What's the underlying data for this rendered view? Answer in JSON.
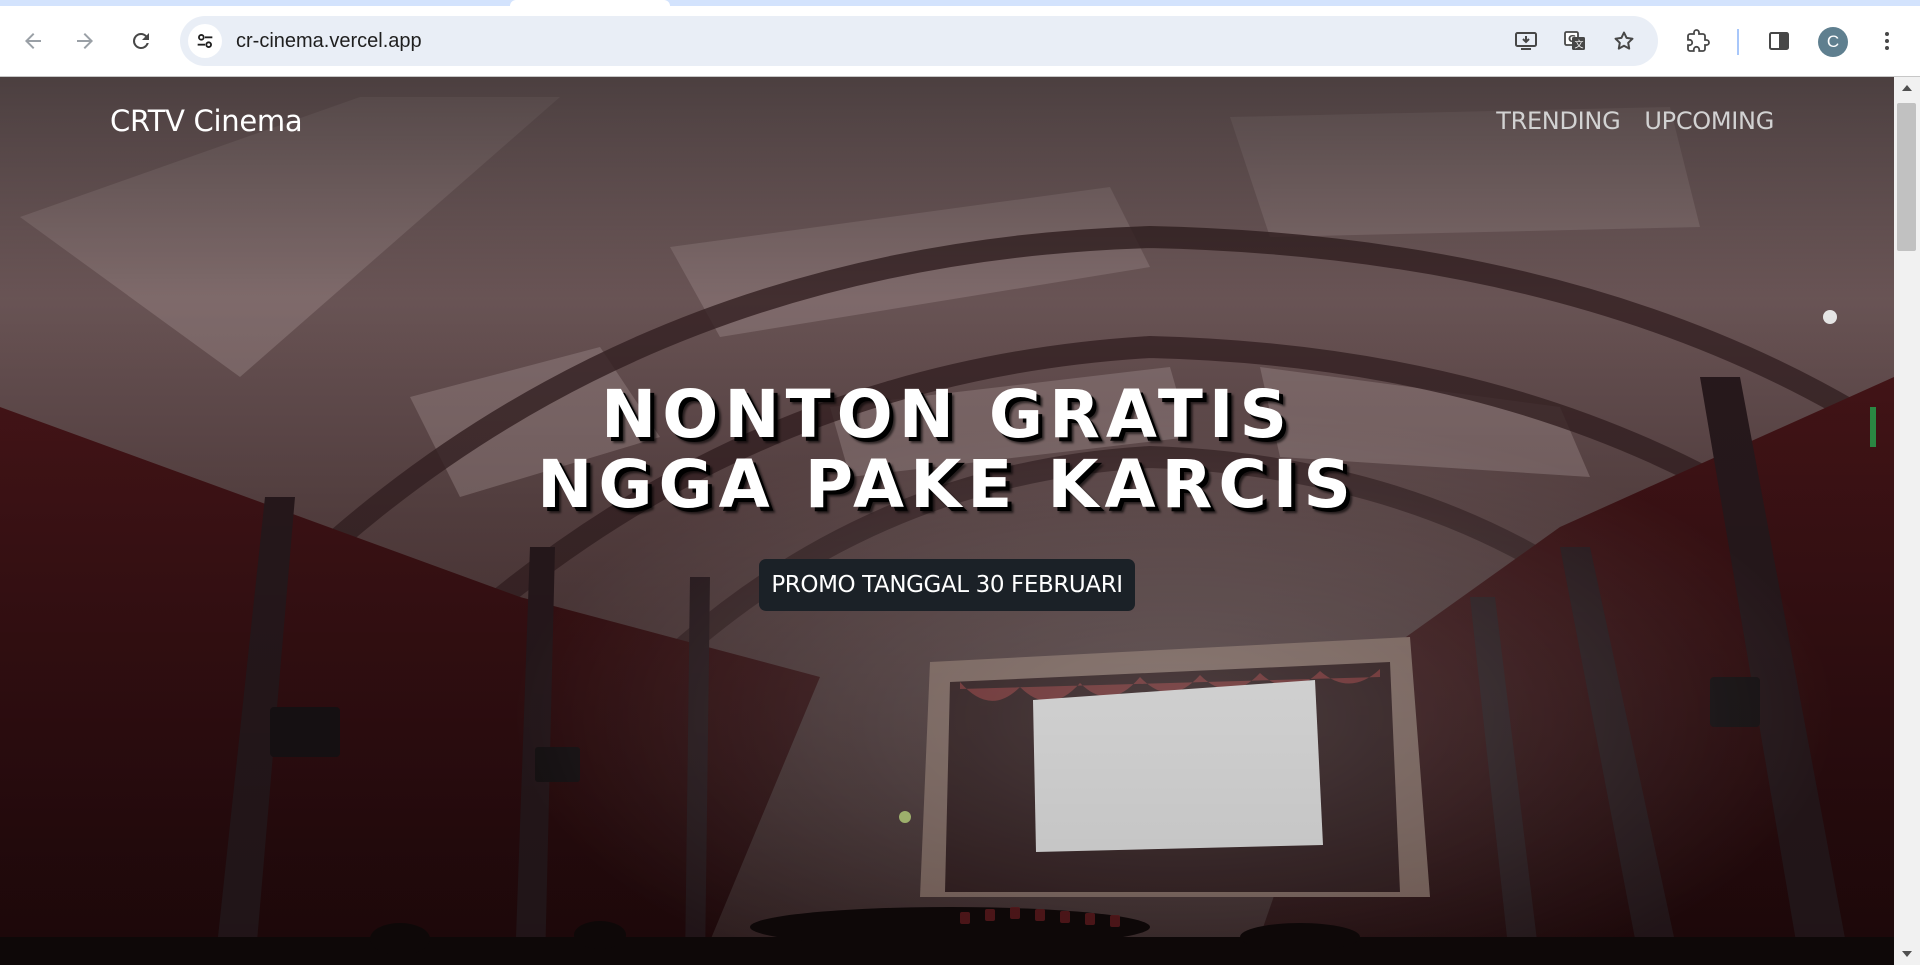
{
  "browser": {
    "url": "cr-cinema.vercel.app",
    "profile_initial": "C",
    "icons": {
      "back": "arrow-left-icon",
      "forward": "arrow-right-icon",
      "reload": "reload-icon",
      "site_info": "tune-icon",
      "install": "install-app-icon",
      "translate": "translate-icon",
      "bookmark": "star-icon",
      "extensions": "puzzle-icon",
      "side_panel": "side-panel-icon",
      "menu": "kebab-menu-icon"
    }
  },
  "site": {
    "brand": "CRTV Cinema",
    "nav": [
      {
        "label": "TRENDING"
      },
      {
        "label": "UPCOMING"
      }
    ],
    "hero": {
      "title_line1": "NONTON GRATIS",
      "title_line2": "NGGA PAKE KARCIS",
      "promo": "PROMO TANGGAL 30 FEBRUARI"
    }
  },
  "colors": {
    "accent": "#1b2127",
    "hero_wall": "#5a1a1f",
    "screen": "#ffffff"
  }
}
